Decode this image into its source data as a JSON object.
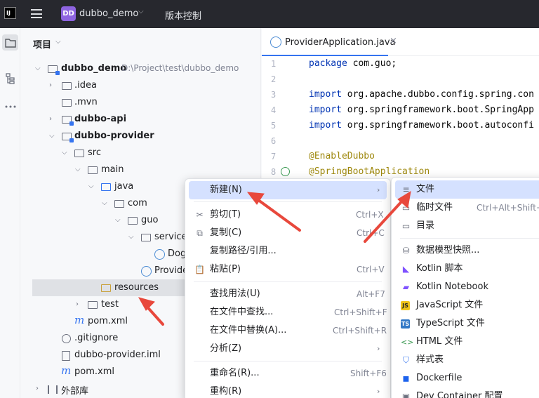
{
  "window": {
    "project_badge": "DD",
    "project_name": "dubbo_demo",
    "vcs_label": "版本控制"
  },
  "project_panel": {
    "title": "项目",
    "tree": [
      {
        "label": "dubbo_demo",
        "hint": "D:\\Project\\test\\dubbo_demo",
        "bold": true
      },
      {
        "label": ".idea"
      },
      {
        "label": ".mvn"
      },
      {
        "label": "dubbo-api",
        "bold": true
      },
      {
        "label": "dubbo-provider",
        "bold": true
      },
      {
        "label": "src"
      },
      {
        "label": "main"
      },
      {
        "label": "java"
      },
      {
        "label": "com"
      },
      {
        "label": "guo"
      },
      {
        "label": "service"
      },
      {
        "label": "Dog"
      },
      {
        "label": "Provide"
      },
      {
        "label": "resources"
      },
      {
        "label": "test"
      },
      {
        "label": "pom.xml"
      },
      {
        "label": ".gitignore"
      },
      {
        "label": "dubbo-provider.iml"
      },
      {
        "label": "pom.xml"
      },
      {
        "label": "外部库"
      }
    ]
  },
  "editor": {
    "tab_label": "ProviderApplication.java",
    "lines": [
      {
        "num": "1",
        "parts": [
          {
            "c": "kw",
            "t": "package"
          },
          {
            "c": "",
            "t": " com.guo;"
          }
        ]
      },
      {
        "num": "2",
        "parts": []
      },
      {
        "num": "3",
        "parts": [
          {
            "c": "kw",
            "t": "import"
          },
          {
            "c": "",
            "t": " org.apache.dubbo.config.spring.con"
          }
        ]
      },
      {
        "num": "4",
        "parts": [
          {
            "c": "kw",
            "t": "import"
          },
          {
            "c": "",
            "t": " org.springframework.boot.SpringApp"
          }
        ]
      },
      {
        "num": "5",
        "parts": [
          {
            "c": "kw",
            "t": "import"
          },
          {
            "c": "",
            "t": " org.springframework.boot.autoconfi"
          }
        ]
      },
      {
        "num": "6",
        "parts": []
      },
      {
        "num": "7",
        "parts": [
          {
            "c": "ann",
            "t": "@EnableDubbo"
          }
        ]
      },
      {
        "num": "8",
        "parts": [
          {
            "c": "ann",
            "t": "@SpringBootApplication"
          }
        ]
      }
    ]
  },
  "context_menu": {
    "items": [
      {
        "label": "新建(N)",
        "shortcut": "",
        "submenu": true,
        "icon": "none"
      },
      {
        "label": "剪切(T)",
        "shortcut": "Ctrl+X",
        "icon": "scissors-icon"
      },
      {
        "label": "复制(C)",
        "shortcut": "Ctrl+C",
        "icon": "copy-icon"
      },
      {
        "label": "复制路径/引用...",
        "shortcut": "",
        "icon": "none"
      },
      {
        "label": "粘贴(P)",
        "shortcut": "Ctrl+V",
        "icon": "paste-icon"
      },
      {
        "label": "查找用法(U)",
        "shortcut": "Alt+F7",
        "icon": "none"
      },
      {
        "label": "在文件中查找...",
        "shortcut": "Ctrl+Shift+F",
        "icon": "none"
      },
      {
        "label": "在文件中替换(A)...",
        "shortcut": "Ctrl+Shift+R",
        "icon": "none"
      },
      {
        "label": "分析(Z)",
        "shortcut": "",
        "submenu": true,
        "icon": "none"
      },
      {
        "label": "重命名(R)...",
        "shortcut": "Shift+F6",
        "icon": "none"
      },
      {
        "label": "重构(R)",
        "shortcut": "",
        "submenu": true,
        "icon": "none"
      }
    ]
  },
  "new_submenu": {
    "items": [
      {
        "label": "文件",
        "shortcut": "",
        "icon": "file-icon"
      },
      {
        "label": "临时文件",
        "shortcut": "Ctrl+Alt+Shift+I",
        "icon": "scratch-file-icon"
      },
      {
        "label": "目录",
        "shortcut": "",
        "icon": "folder-icon"
      },
      {
        "label": "数据模型快照...",
        "shortcut": "",
        "icon": "database-icon"
      },
      {
        "label": "Kotlin 脚本",
        "shortcut": "",
        "icon": "kotlin-icon"
      },
      {
        "label": "Kotlin Notebook",
        "shortcut": "",
        "icon": "notebook-icon"
      },
      {
        "label": "JavaScript 文件",
        "shortcut": "",
        "icon": "javascript-icon"
      },
      {
        "label": "TypeScript 文件",
        "shortcut": "",
        "icon": "typescript-icon"
      },
      {
        "label": "HTML 文件",
        "shortcut": "",
        "icon": "html-icon"
      },
      {
        "label": "样式表",
        "shortcut": "",
        "icon": "css-icon"
      },
      {
        "label": "Dockerfile",
        "shortcut": "",
        "icon": "docker-icon"
      },
      {
        "label": "Dev Container 配置",
        "shortcut": "",
        "icon": "dev-container-icon"
      }
    ]
  },
  "colors": {
    "accent": "#3574f0",
    "annotation_arrow": "#e8483c",
    "menu_highlight": "#d5e1ff",
    "topbar_bg": "#27282e"
  }
}
